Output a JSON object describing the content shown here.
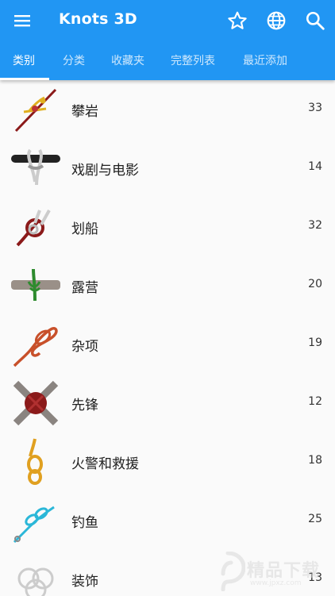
{
  "app": {
    "title": "Knots 3D"
  },
  "toolbar": {
    "menu_icon": "menu-icon",
    "star_icon": "star-outline-icon",
    "globe_icon": "globe-icon",
    "search_icon": "search-icon"
  },
  "tabs": [
    {
      "label": "类别",
      "active": true
    },
    {
      "label": "分类",
      "active": false
    },
    {
      "label": "收藏夹",
      "active": false
    },
    {
      "label": "完整列表",
      "active": false
    },
    {
      "label": "最近添加",
      "active": false
    }
  ],
  "categories": [
    {
      "label": "攀岩",
      "count": "33",
      "icon": "climbing-knot-icon"
    },
    {
      "label": "戏剧与电影",
      "count": "14",
      "icon": "theater-knot-icon"
    },
    {
      "label": "划船",
      "count": "32",
      "icon": "boating-knot-icon"
    },
    {
      "label": "露营",
      "count": "20",
      "icon": "camping-knot-icon"
    },
    {
      "label": "杂项",
      "count": "19",
      "icon": "misc-knot-icon"
    },
    {
      "label": "先锋",
      "count": "12",
      "icon": "pioneering-knot-icon"
    },
    {
      "label": "火警和救援",
      "count": "18",
      "icon": "fire-rescue-knot-icon"
    },
    {
      "label": "钓鱼",
      "count": "25",
      "icon": "fishing-knot-icon"
    },
    {
      "label": "装饰",
      "count": "13",
      "icon": "decorative-knot-icon"
    }
  ],
  "watermark": {
    "text": "精品下载",
    "sub": "www.jpxz.com"
  },
  "colors": {
    "primary": "#2196f3",
    "background": "#fafafa",
    "text": "#212121"
  }
}
